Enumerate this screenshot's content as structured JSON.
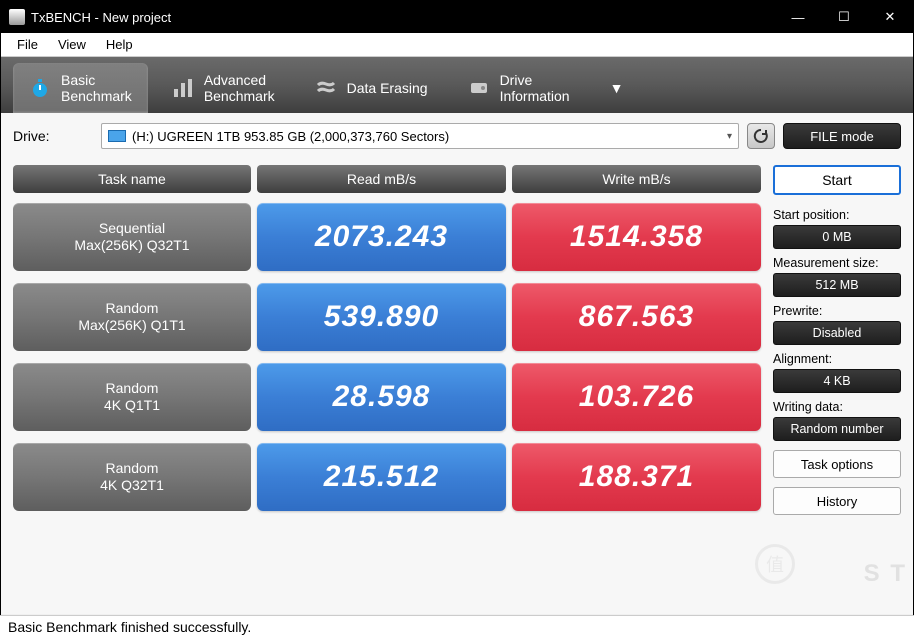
{
  "window": {
    "title": "TxBENCH - New project",
    "min": "—",
    "max": "☐",
    "close": "✕"
  },
  "menu": {
    "file": "File",
    "view": "View",
    "help": "Help"
  },
  "tabs": {
    "basic1": "Basic",
    "basic2": "Benchmark",
    "adv1": "Advanced",
    "adv2": "Benchmark",
    "erase": "Data Erasing",
    "drive1": "Drive",
    "drive2": "Information"
  },
  "drive": {
    "label": "Drive:",
    "value": "(H:) UGREEN  1TB  953.85 GB (2,000,373,760 Sectors)",
    "refresh": "↻",
    "filemode": "FILE mode"
  },
  "headers": {
    "task": "Task name",
    "read": "Read mB/s",
    "write": "Write mB/s"
  },
  "tests": [
    {
      "name1": "Sequential",
      "name2": "Max(256K) Q32T1",
      "read": "2073.243",
      "write": "1514.358"
    },
    {
      "name1": "Random",
      "name2": "Max(256K) Q1T1",
      "read": "539.890",
      "write": "867.563"
    },
    {
      "name1": "Random",
      "name2": "4K Q1T1",
      "read": "28.598",
      "write": "103.726"
    },
    {
      "name1": "Random",
      "name2": "4K Q32T1",
      "read": "215.512",
      "write": "188.371"
    }
  ],
  "side": {
    "start": "Start",
    "startpos_l": "Start position:",
    "startpos_v": "0 MB",
    "msize_l": "Measurement size:",
    "msize_v": "512 MB",
    "prewrite_l": "Prewrite:",
    "prewrite_v": "Disabled",
    "align_l": "Alignment:",
    "align_v": "4 KB",
    "wdata_l": "Writing data:",
    "wdata_v": "Random number",
    "taskopt": "Task options",
    "history": "History"
  },
  "status": "Basic Benchmark finished successfully.",
  "watermark": "S    T"
}
